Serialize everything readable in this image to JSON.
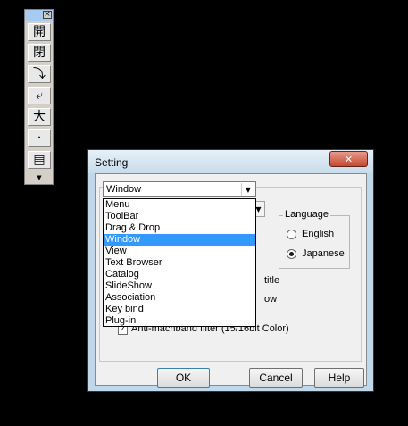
{
  "toolbar": {
    "close_glyph": "×",
    "buttons": [
      {
        "label": "開",
        "icon": "open-file-icon"
      },
      {
        "label": "閉",
        "icon": "close-file-icon"
      },
      {
        "label": "⤵",
        "icon": "redo-icon"
      },
      {
        "label": "⤶",
        "icon": "undo-icon"
      },
      {
        "label": "大",
        "icon": "enlarge-icon"
      },
      {
        "label": "・",
        "icon": "small-icon"
      },
      {
        "label": "▤",
        "icon": "document-icon"
      }
    ],
    "more_glyph": "▼"
  },
  "dialog": {
    "title": "Setting",
    "close_glyph": "✕",
    "combo": {
      "value": "Window",
      "arrow": "▼"
    },
    "dropdown": {
      "items": [
        "Menu",
        "ToolBar",
        "Drag & Drop",
        "Window",
        "View",
        "Text Browser",
        "Catalog",
        "SlideShow",
        "Association",
        "Key bind",
        "Plug-in"
      ],
      "selected_index": 3
    },
    "language": {
      "legend": "Language",
      "options": [
        {
          "label": "English",
          "checked": false
        },
        {
          "label": "Japanese",
          "checked": true
        }
      ]
    },
    "hidden_options": {
      "title_suffix": "title",
      "ow_suffix": "ow",
      "antimachband": "Anti-machband filter (15/16bit Color)"
    },
    "buttons": {
      "ok": "OK",
      "cancel": "Cancel",
      "help": "Help"
    }
  }
}
